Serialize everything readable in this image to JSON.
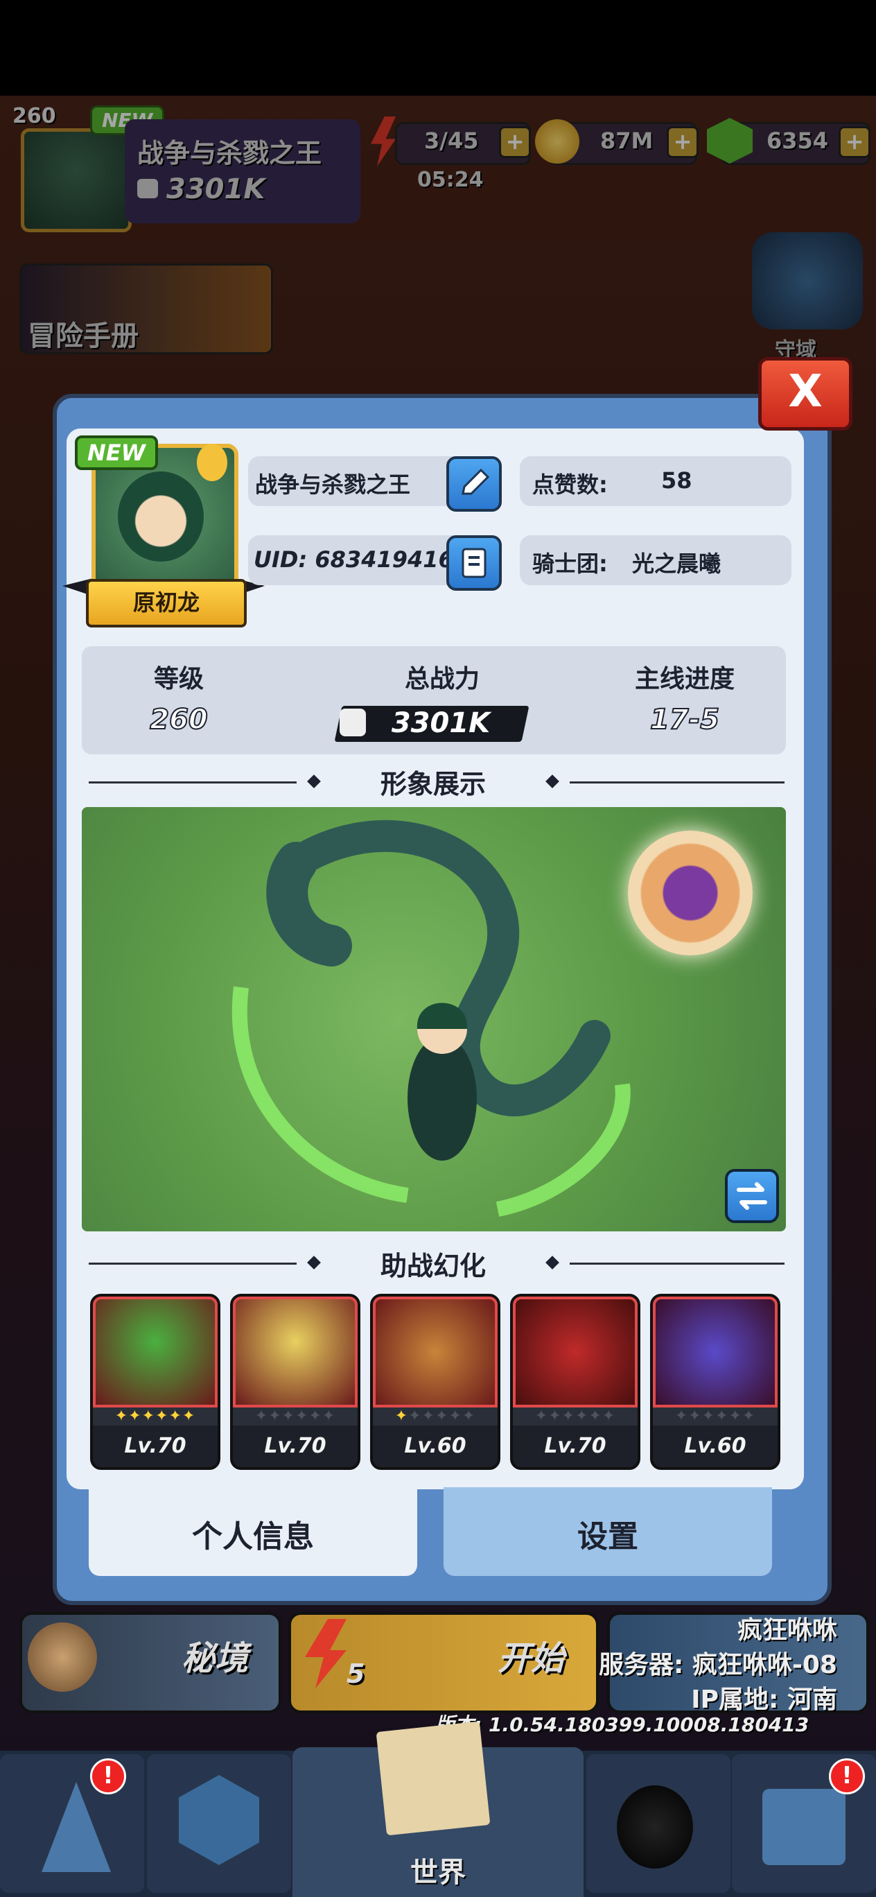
{
  "hud": {
    "level": "260",
    "new_badge": "NEW",
    "player_name": "战争与杀戮之王",
    "power": "3301K",
    "energy": "3/45",
    "energy_timer": "05:24",
    "coins": "87M",
    "gems": "6354",
    "plus": "+"
  },
  "side": {
    "handbook": "冒险手册",
    "domain": "守域"
  },
  "modal": {
    "close": "X",
    "new_tag": "NEW",
    "hero_name": "原初龙",
    "player_name": "战争与杀戮之王",
    "uid": "UID: 683419416",
    "likes_label": "点赞数:",
    "likes_value": "58",
    "guild_label": "骑士团:",
    "guild_value": "光之晨曦",
    "stats": {
      "level_label": "等级",
      "level_value": "260",
      "power_label": "总战力",
      "power_value": "3301K",
      "progress_label": "主线进度",
      "progress_value": "17-5"
    },
    "showcase_title": "形象展示",
    "assist_title": "助战幻化",
    "assist_cards": [
      {
        "level": "Lv.70",
        "stars": 6
      },
      {
        "level": "Lv.70",
        "stars": 0
      },
      {
        "level": "Lv.60",
        "stars": 1
      },
      {
        "level": "Lv.70",
        "stars": 0
      },
      {
        "level": "Lv.60",
        "stars": 0
      }
    ],
    "tab_personal": "个人信息",
    "tab_settings": "设置"
  },
  "bottom": {
    "secret_realm": "秘境",
    "start": "开始",
    "start_cost": "5",
    "server_player": "疯狂咻咻",
    "server": "服务器: 疯狂咻咻-08",
    "ip": "IP属地: 河南",
    "version": "版本: 1.0.54.180399.10008.180413",
    "world": "世界",
    "badge_mark": "!"
  },
  "colors": {
    "modal_frame": "#5a8ac6",
    "panel": "#eaf0f8",
    "accent_gold": "#e8b53a",
    "close_red": "#e0392a",
    "button_blue": "#3a8ee0"
  }
}
